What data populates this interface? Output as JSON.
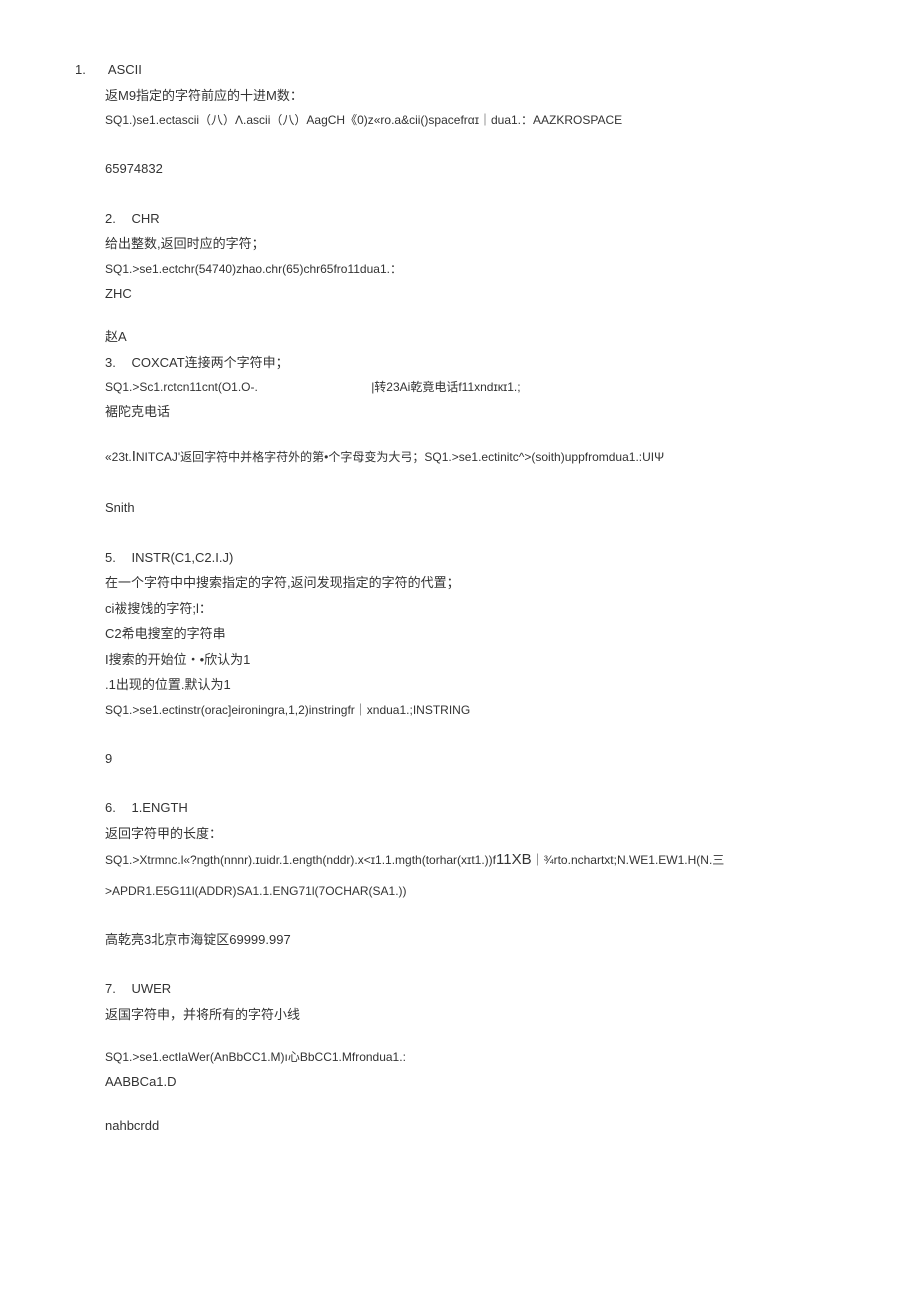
{
  "s1": {
    "num": "1.",
    "title": "ASCII",
    "desc": "返M9指定的字符前应的十进M数：",
    "sql": "SQ1.)se1.ectascii（八）Λ.ascii（八）AagCH《0)z«ro.a&cii()spacefrαɪ｜dua1.：AAZKROSPACE",
    "result": "65974832"
  },
  "s2": {
    "num": "2.",
    "title": "CHR",
    "desc": "给出整数,返回时应的字符；",
    "sql": "SQ1.>se1.ectchr(54740)zhao.chr(65)chr65fro11dua1.：",
    "result1": "ZHC",
    "result2": "赵A"
  },
  "s3": {
    "num": "3.",
    "title": "COXCAT连接两个字符申；",
    "sql_left": "SQ1.>Sc1.rctcn11cnt(O1.O-.",
    "sql_right": "|转23Ai乾竟电话f11xndɪкɪ1.;",
    "result": "裾陀克电话"
  },
  "s4": {
    "line": "«23t.ΙNITCAJ'返回字符中并格字苻外的第•个字母变为大弓；SQ1.>se1.ectinitc^>(soith)uppfromdua1.:UIΨ",
    "result": "Snith"
  },
  "s5": {
    "num": "5.",
    "title": "INSTR(C1,C2.I.J)",
    "desc1": "在一个字符中中搜索指定的字符,返问发现指定的字符的代置；",
    "desc2": "ci袚搜饯的字符;l：",
    "desc3": "C2希电搜室的字符串",
    "desc4": "I搜索的开始位・•欣认为1",
    "desc5": ".1出现的位置.默认为1",
    "sql": "SQ1.>se1.ectinstr(orac]eironingra,1,2)instringfr｜xndua1.;INSTRING",
    "result": "9"
  },
  "s6": {
    "num": "6.",
    "title": "1.ENGTH",
    "desc": "返回字符甲的长度：",
    "sql1": "SQ1.>Xtrmnc.l«?ngth(nnnr).ɪuidr.1.ength(nddr).x<ɪ1.1.mgth(torhar(xɪt1.))f11XB｜¾rto.nchartxt;N.WE1.EW1.H(N.三",
    "sql2": ">APDR1.E5G11l(ADDR)SA1.1.ENG71l(7OCHAR(SA1.))",
    "result": "高乾亮3北京市海锭区69999.997"
  },
  "s7": {
    "num": "7.",
    "title": "UWER",
    "desc": "返国字符申，并将所有的字符小线",
    "sql": "SQ1.>se1.ectIaWer(AnBbCC1.M)ı心BbCC1.Mfrondua1.:",
    "result1": "AABBCa1.D",
    "result2": "nahbcrdd"
  }
}
